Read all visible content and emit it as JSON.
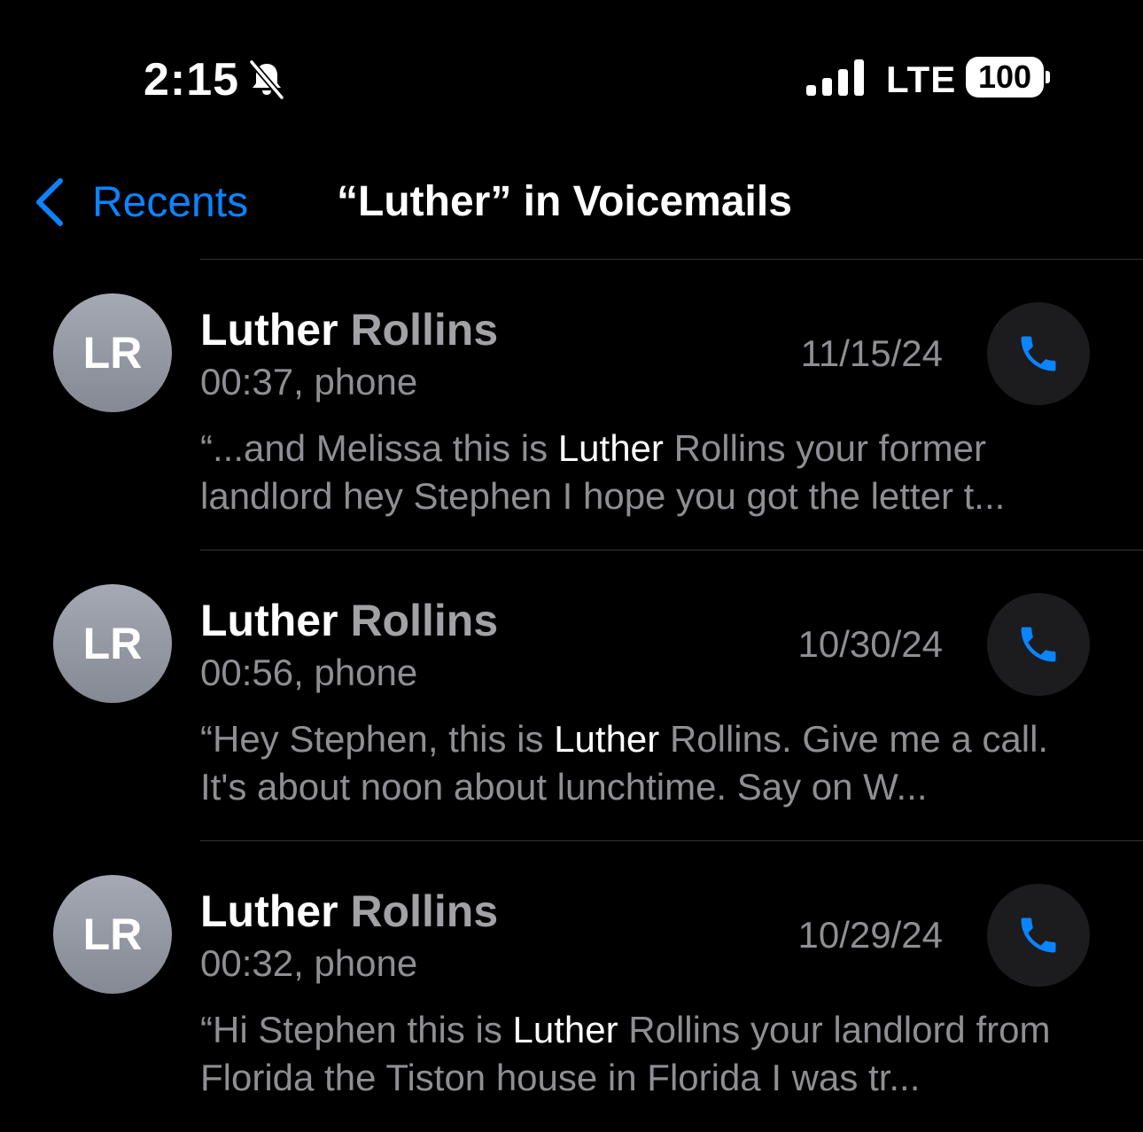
{
  "status_bar": {
    "time": "2:15",
    "network": "LTE",
    "battery": "100",
    "icons": [
      "bell-slash-icon",
      "cellular-signal-icon",
      "battery-icon"
    ]
  },
  "nav": {
    "back_label": "Recents",
    "title": "“Luther” in Voicemails"
  },
  "colors": {
    "accent": "#0a84ff",
    "background": "#000000",
    "secondary_text": "#8e8e93",
    "call_button_bg": "#1c1c1e"
  },
  "voicemails": [
    {
      "initials": "LR",
      "first_name": "Luther",
      "last_name": "Rollins",
      "meta": "00:37, phone",
      "date": "11/15/24",
      "transcript_before": "“...and Melissa this is ",
      "transcript_match": "Luther",
      "transcript_after": " Rollins your former landlord hey Stephen I hope you got the letter t..."
    },
    {
      "initials": "LR",
      "first_name": "Luther",
      "last_name": "Rollins",
      "meta": "00:56, phone",
      "date": "10/30/24",
      "transcript_before": "“Hey Stephen, this is ",
      "transcript_match": "Luther",
      "transcript_after": " Rollins. Give me a call. It's about noon about lunchtime. Say on W..."
    },
    {
      "initials": "LR",
      "first_name": "Luther",
      "last_name": "Rollins",
      "meta": "00:32, phone",
      "date": "10/29/24",
      "transcript_before": "“Hi Stephen this is ",
      "transcript_match": "Luther",
      "transcript_after": " Rollins your landlord from Florida the Tiston house in Florida I was tr..."
    }
  ]
}
